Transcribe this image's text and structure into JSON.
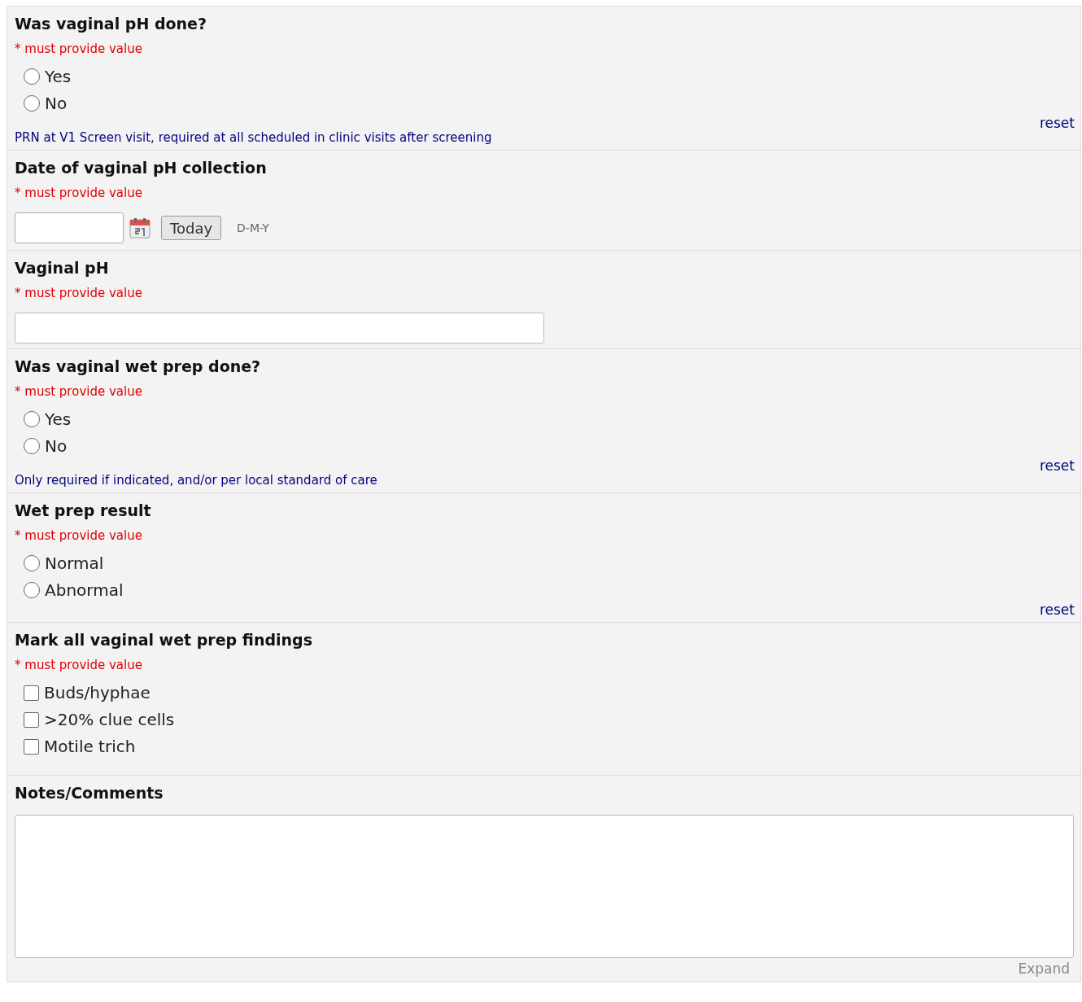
{
  "fields": [
    {
      "kind": "radio",
      "label": "Was vaginal pH done?",
      "required": "* must provide value",
      "options": [
        {
          "label": "Yes",
          "selected": false
        },
        {
          "label": "No",
          "selected": false
        }
      ],
      "reset": "reset",
      "note": "PRN at V1 Screen visit, required at all scheduled in clinic visits after screening"
    },
    {
      "kind": "date",
      "label": "Date of vaginal pH collection",
      "required": "* must provide value",
      "button": "Today",
      "format": "D-M-Y"
    },
    {
      "kind": "text",
      "label": "Vaginal pH",
      "required": "* must provide value"
    },
    {
      "kind": "radio",
      "label": "Was vaginal wet prep done?",
      "required": "* must provide value",
      "options": [
        {
          "label": "Yes",
          "selected": false
        },
        {
          "label": "No",
          "selected": false
        }
      ],
      "reset": "reset",
      "note": "Only required if indicated, and/or per local standard of care"
    },
    {
      "kind": "radio",
      "label": "Wet prep result",
      "required": "* must provide value",
      "options": [
        {
          "label": "Normal",
          "selected": false
        },
        {
          "label": "Abnormal",
          "selected": false
        }
      ],
      "reset": "reset"
    },
    {
      "kind": "checkbox",
      "label": "Mark all vaginal wet prep findings",
      "required": "* must provide value",
      "options": [
        {
          "label": "Buds/hyphae",
          "checked": false
        },
        {
          "label": ">20% clue cells",
          "checked": false
        },
        {
          "label": "Motile trich",
          "checked": false
        }
      ]
    },
    {
      "kind": "textarea",
      "label": "Notes/Comments",
      "expand": "Expand"
    }
  ]
}
